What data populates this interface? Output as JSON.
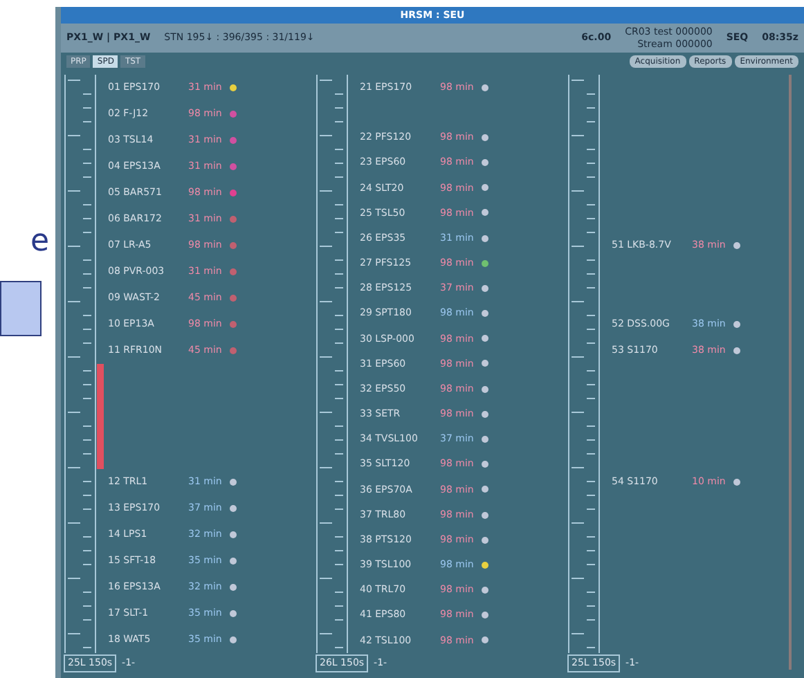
{
  "slide": {
    "letter": "e"
  },
  "window": {
    "title": "HRSM : SEU"
  },
  "header": {
    "station": "PX1_W | PX1_W",
    "summary": "STN 195↓ : 396/395 : 31/119↓",
    "code": "6c.00",
    "test": "CR03 test 000000",
    "stream": "Stream 000000",
    "seq": "SEQ",
    "time": "08:35z"
  },
  "tabs": [
    {
      "label": "PRP",
      "selected": false
    },
    {
      "label": "SPD",
      "selected": true
    },
    {
      "label": "TST",
      "selected": false
    }
  ],
  "actions": [
    "Acquisition",
    "Reports",
    "Environment"
  ],
  "columns": [
    {
      "footer": "25L 150s",
      "page": "-1-",
      "rows": [
        {
          "kind": "entry",
          "name": "01 EPS170",
          "value": "31 min",
          "alarm": true,
          "color": "#e8d040"
        },
        {
          "kind": "entry",
          "name": "02 F-J12",
          "value": "98 min",
          "alarm": true,
          "color": "#d050a0"
        },
        {
          "kind": "entry",
          "name": "03 TSL14",
          "value": "31 min",
          "alarm": true,
          "color": "#d050a0"
        },
        {
          "kind": "entry",
          "name": "04 EPS13A",
          "value": "31 min",
          "alarm": true,
          "color": "#d050a0"
        },
        {
          "kind": "entry",
          "name": "05 BAR571",
          "value": "98 min",
          "alarm": true,
          "color": "#e04090"
        },
        {
          "kind": "entry",
          "name": "06 BAR172",
          "value": "31 min",
          "alarm": true,
          "color": "#c06070"
        },
        {
          "kind": "entry",
          "name": "07 LR-A5",
          "value": "98 min",
          "alarm": true,
          "color": "#c06070"
        },
        {
          "kind": "entry",
          "name": "08 PVR-003",
          "value": "31 min",
          "alarm": true,
          "color": "#c06070"
        },
        {
          "kind": "entry",
          "name": "09 WAST-2",
          "value": "45 min",
          "alarm": true,
          "color": "#c06070"
        },
        {
          "kind": "entry",
          "name": "10 EP13A",
          "value": "98 min",
          "alarm": true,
          "color": "#c06070"
        },
        {
          "kind": "entry",
          "name": "11 RFR10N",
          "value": "45 min",
          "alarm": true,
          "color": "#c06070"
        },
        {
          "kind": "range"
        },
        {
          "kind": "range"
        },
        {
          "kind": "range"
        },
        {
          "kind": "range"
        },
        {
          "kind": "entry",
          "name": "12 TRL1",
          "value": "31 min",
          "alarm": false,
          "color": "#c0c8d8"
        },
        {
          "kind": "entry",
          "name": "13 EPS170",
          "value": "37 min",
          "alarm": false,
          "color": "#c0c8d8"
        },
        {
          "kind": "entry",
          "name": "14 LPS1",
          "value": "32 min",
          "alarm": false,
          "color": "#c0c8d8"
        },
        {
          "kind": "entry",
          "name": "15 SFT-18",
          "value": "35 min",
          "alarm": false,
          "color": "#c0c8d8"
        },
        {
          "kind": "entry",
          "name": "16 EPS13A",
          "value": "32 min",
          "alarm": false,
          "color": "#c0c8d8"
        },
        {
          "kind": "entry",
          "name": "17 SLT-1",
          "value": "35 min",
          "alarm": false,
          "color": "#c0c8d8"
        },
        {
          "kind": "entry",
          "name": "18 WAT5",
          "value": "35 min",
          "alarm": false,
          "color": "#c0c8d8"
        }
      ]
    },
    {
      "footer": "26L 150s",
      "page": "-1-",
      "rows": [
        {
          "kind": "entry",
          "name": "21 EPS170",
          "value": "98 min",
          "alarm": true,
          "color": "#c0c8d8"
        },
        {
          "kind": "gap"
        },
        {
          "kind": "entry",
          "name": "22 PFS120",
          "value": "98 min",
          "alarm": true,
          "color": "#c0c8d8"
        },
        {
          "kind": "entry",
          "name": "23 EPS60",
          "value": "98 min",
          "alarm": true,
          "color": "#c0c8d8"
        },
        {
          "kind": "entry",
          "name": "24 SLT20",
          "value": "98 min",
          "alarm": true,
          "color": "#c0c8d8"
        },
        {
          "kind": "entry",
          "name": "25 TSL50",
          "value": "98 min",
          "alarm": true,
          "color": "#c0c8d8"
        },
        {
          "kind": "entry",
          "name": "26 EPS35",
          "value": "31 min",
          "alarm": false,
          "color": "#c0c8d8"
        },
        {
          "kind": "entry",
          "name": "27 PFS125",
          "value": "98 min",
          "alarm": true,
          "color": "#70c070"
        },
        {
          "kind": "entry",
          "name": "28 EPS125",
          "value": "37 min",
          "alarm": true,
          "color": "#c0c8d8"
        },
        {
          "kind": "entry",
          "name": "29 SPT180",
          "value": "98 min",
          "alarm": false,
          "color": "#c0c8d8"
        },
        {
          "kind": "entry",
          "name": "30 LSP-000",
          "value": "98 min",
          "alarm": true,
          "color": "#c0c8d8"
        },
        {
          "kind": "entry",
          "name": "31 EPS60",
          "value": "98 min",
          "alarm": true,
          "color": "#c0c8d8"
        },
        {
          "kind": "entry",
          "name": "32 EPS50",
          "value": "98 min",
          "alarm": true,
          "color": "#c0c8d8"
        },
        {
          "kind": "entry",
          "name": "33 SETR",
          "value": "98 min",
          "alarm": true,
          "color": "#c0c8d8"
        },
        {
          "kind": "entry",
          "name": "34 TVSL100",
          "value": "37 min",
          "alarm": false,
          "color": "#c0c8d8"
        },
        {
          "kind": "entry",
          "name": "35 SLT120",
          "value": "98 min",
          "alarm": true,
          "color": "#c0c8d8"
        },
        {
          "kind": "entry",
          "name": "36 EPS70A",
          "value": "98 min",
          "alarm": true,
          "color": "#c0c8d8"
        },
        {
          "kind": "entry",
          "name": "37 TRL80",
          "value": "98 min",
          "alarm": true,
          "color": "#c0c8d8"
        },
        {
          "kind": "entry",
          "name": "38 PTS120",
          "value": "98 min",
          "alarm": true,
          "color": "#c0c8d8"
        },
        {
          "kind": "entry",
          "name": "39 TSL100",
          "value": "98 min",
          "alarm": false,
          "color": "#e8d040"
        },
        {
          "kind": "entry",
          "name": "40 TRL70",
          "value": "98 min",
          "alarm": true,
          "color": "#c0c8d8"
        },
        {
          "kind": "entry",
          "name": "41 EPS80",
          "value": "98 min",
          "alarm": true,
          "color": "#c0c8d8"
        },
        {
          "kind": "entry",
          "name": "42 TSL100",
          "value": "98 min",
          "alarm": true,
          "color": "#c0c8d8"
        }
      ]
    },
    {
      "footer": "25L 150s",
      "page": "-1-",
      "rows": [
        {
          "kind": "gap"
        },
        {
          "kind": "gap"
        },
        {
          "kind": "gap"
        },
        {
          "kind": "gap"
        },
        {
          "kind": "gap"
        },
        {
          "kind": "gap"
        },
        {
          "kind": "entry",
          "name": "51 LKB-8.7V",
          "value": "38 min",
          "alarm": true,
          "color": "#c0c8d8"
        },
        {
          "kind": "gap"
        },
        {
          "kind": "gap"
        },
        {
          "kind": "entry",
          "name": "52 DSS.00G",
          "value": "38 min",
          "alarm": false,
          "color": "#c0c8d8"
        },
        {
          "kind": "entry",
          "name": "53 S1170",
          "value": "38 min",
          "alarm": true,
          "color": "#c0c8d8"
        },
        {
          "kind": "gap"
        },
        {
          "kind": "gap"
        },
        {
          "kind": "gap"
        },
        {
          "kind": "gap"
        },
        {
          "kind": "entry",
          "name": "54 S1170",
          "value": "10 min",
          "alarm": true,
          "color": "#c0c8d8"
        }
      ]
    }
  ]
}
